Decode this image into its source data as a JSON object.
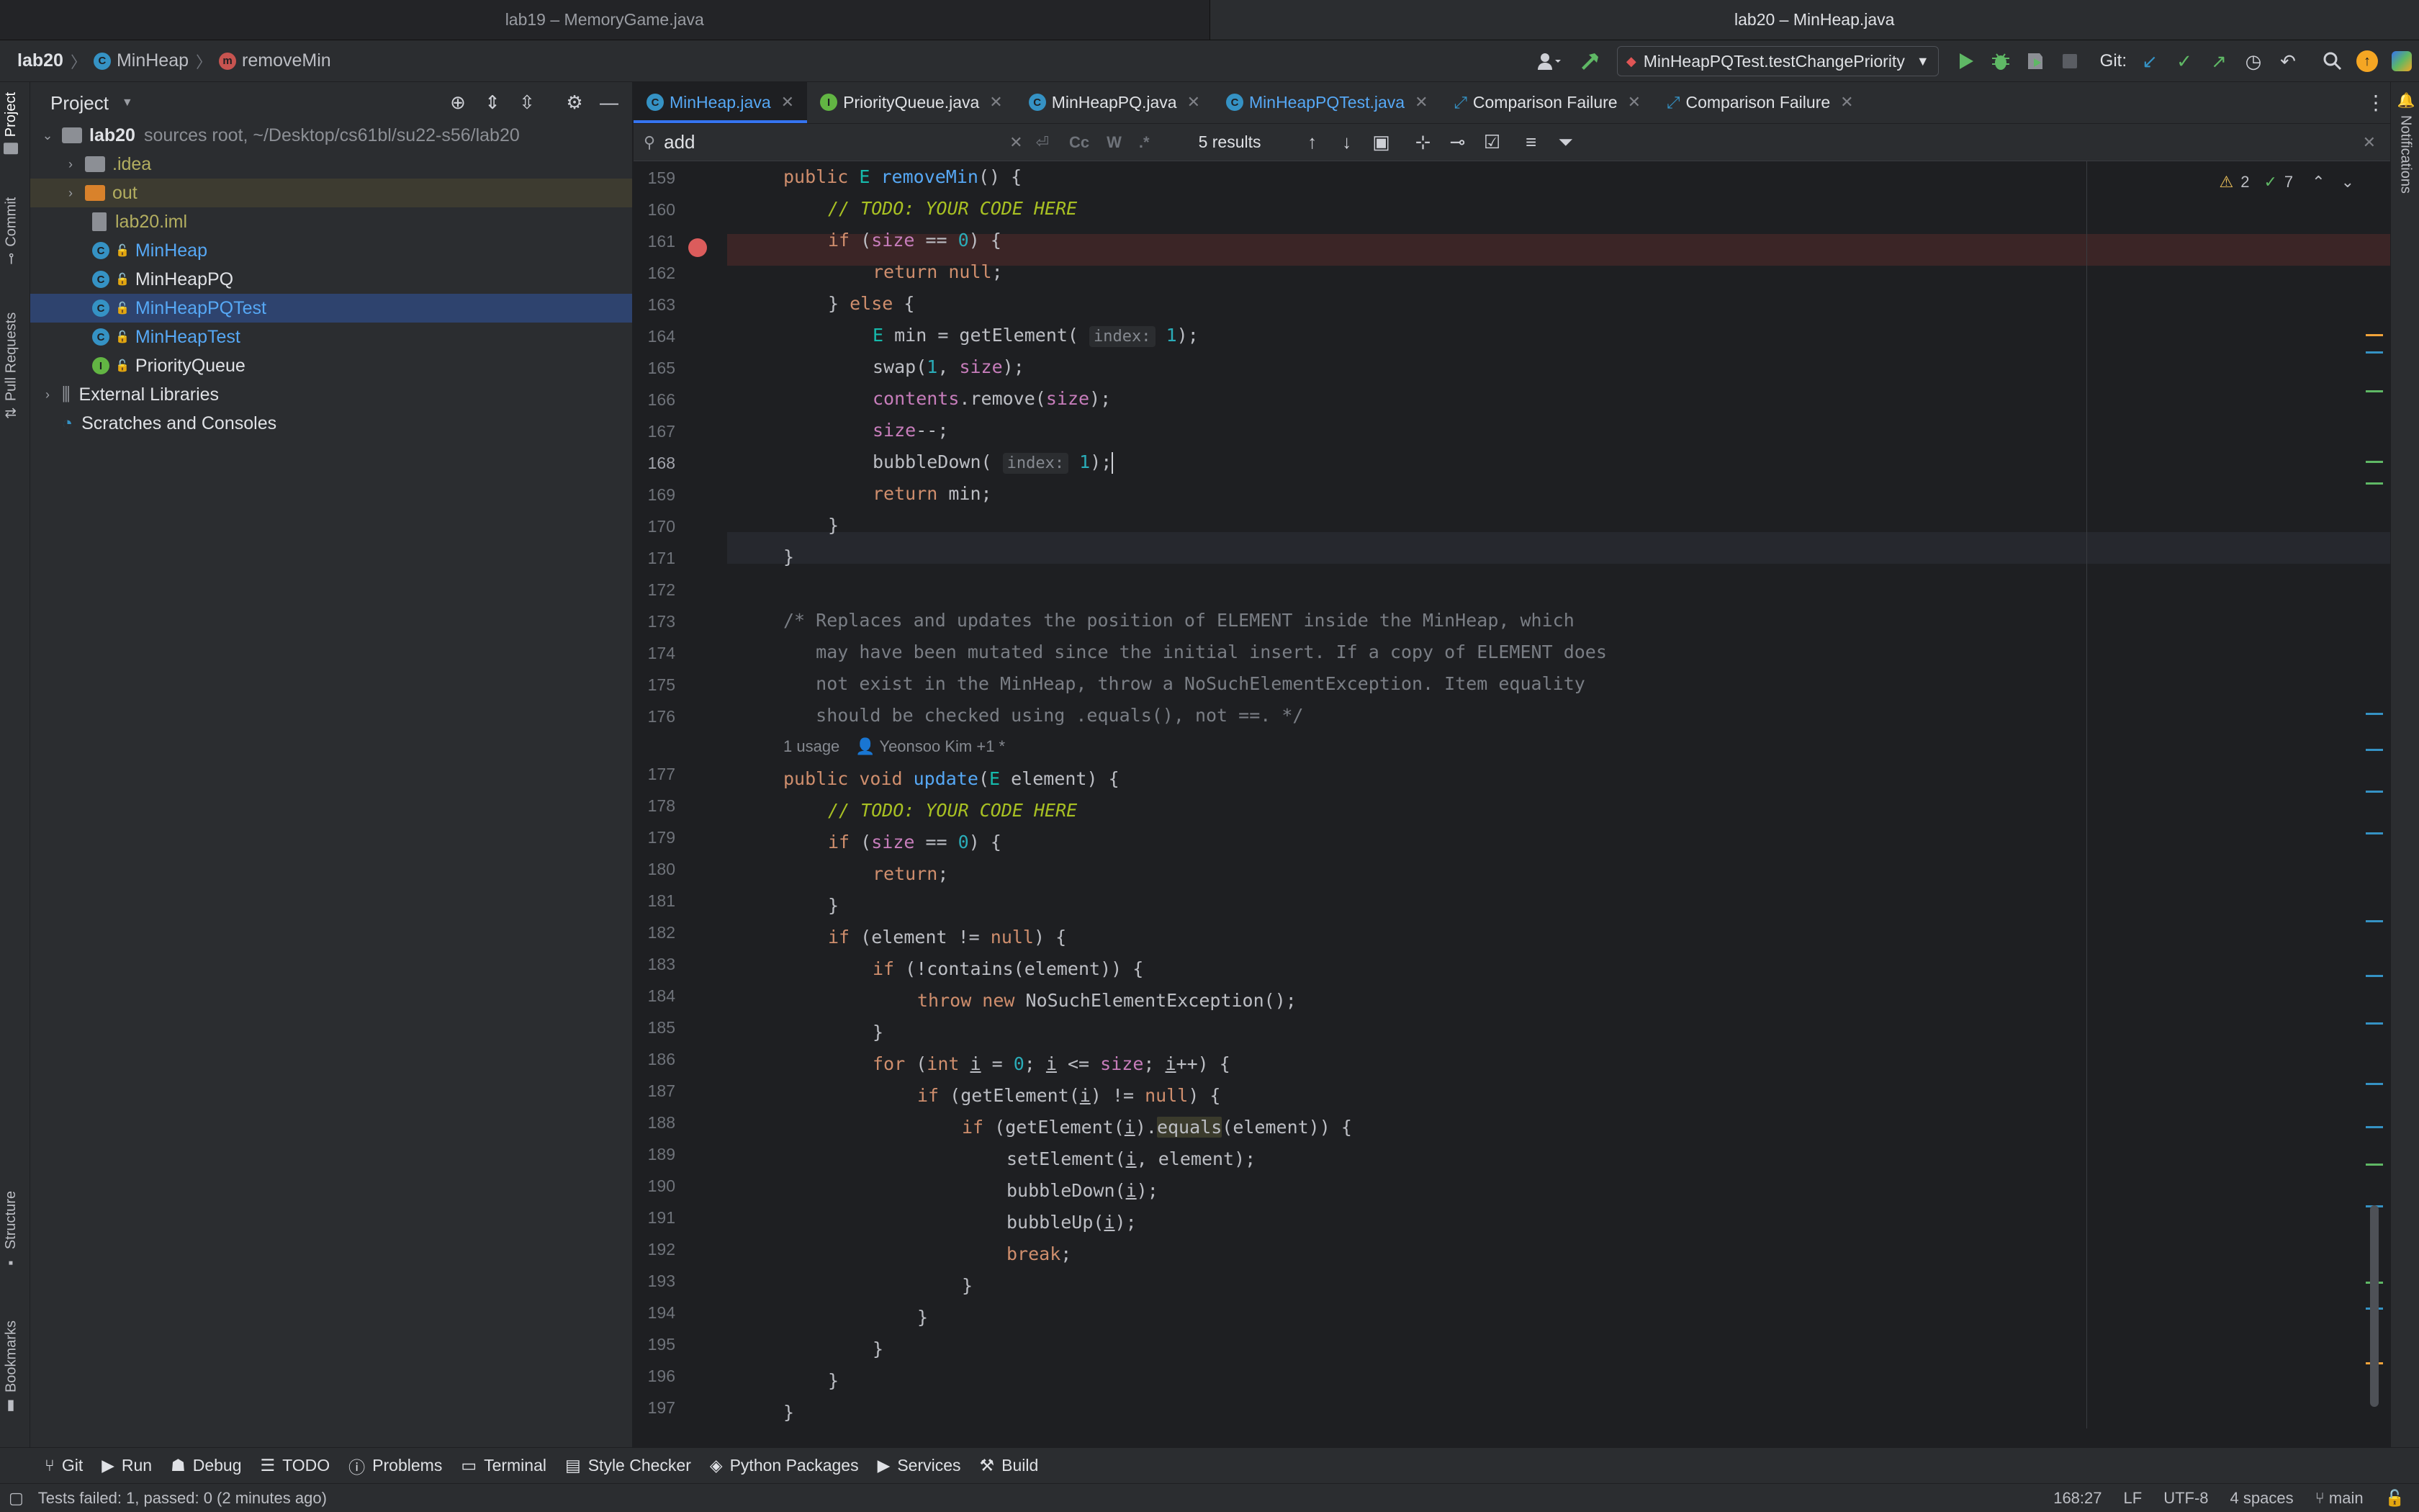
{
  "window_tabs": [
    "lab19 – MemoryGame.java",
    "lab20 – MinHeap.java"
  ],
  "breadcrumb": {
    "project": "lab20",
    "class": "MinHeap",
    "method": "removeMin"
  },
  "run_config": "MinHeapPQTest.testChangePriority",
  "git_label": "Git:",
  "project_panel": {
    "title": "Project",
    "root": {
      "name": "lab20",
      "detail": "sources root, ~/Desktop/cs61bl/su22-s56/lab20"
    },
    "items": [
      ".idea",
      "out",
      "lab20.iml",
      "MinHeap",
      "MinHeapPQ",
      "MinHeapPQTest",
      "MinHeapTest",
      "PriorityQueue"
    ],
    "external": "External Libraries",
    "scratches": "Scratches and Consoles"
  },
  "left_stripe": {
    "project": "Project",
    "commit": "Commit",
    "pull": "Pull Requests",
    "structure": "Structure",
    "bookmarks": "Bookmarks"
  },
  "right_stripe": {
    "notifications": "Notifications"
  },
  "editor_tabs": [
    "MinHeap.java",
    "PriorityQueue.java",
    "MinHeapPQ.java",
    "MinHeapPQTest.java",
    "Comparison Failure",
    "Comparison Failure"
  ],
  "find": {
    "query": "add",
    "case_label": "Cc",
    "word_label": "W",
    "regex_label": ".*",
    "results": "5 results"
  },
  "inspections": {
    "warnings": "2",
    "ok": "7"
  },
  "code": {
    "usage_info": "1 usage",
    "author": "Yeonsoo Kim +1 *",
    "line_numbers": [
      "159",
      "160",
      "161",
      "162",
      "163",
      "164",
      "165",
      "166",
      "167",
      "168",
      "169",
      "170",
      "171",
      "172",
      "173",
      "174",
      "175",
      "176",
      "",
      "177",
      "178",
      "179",
      "180",
      "181",
      "182",
      "183",
      "184",
      "185",
      "186",
      "187",
      "188",
      "189",
      "190",
      "191",
      "192",
      "193",
      "194",
      "195",
      "196",
      "197"
    ],
    "hint_index": "index:",
    "todo": "// TODO: YOUR CODE HERE",
    "comment_lines": [
      "/* Replaces and updates the position of ELEMENT inside the MinHeap, which",
      "   may have been mutated since the initial insert. If a copy of ELEMENT does",
      "   not exist in the MinHeap, throw a NoSuchElementException. Item equality",
      "   should be checked using .equals(), not ==. */"
    ]
  },
  "tool_windows": [
    "Git",
    "Run",
    "Debug",
    "TODO",
    "Problems",
    "Terminal",
    "Style Checker",
    "Python Packages",
    "Services",
    "Build"
  ],
  "status": {
    "message": "Tests failed: 1, passed: 0 (2 minutes ago)",
    "position": "168:27",
    "line_sep": "LF",
    "encoding": "UTF-8",
    "indent": "4 spaces",
    "branch": "main"
  },
  "colors": {
    "accent": "#3574f0",
    "keyword": "#cf8e6d",
    "function": "#56a8f5",
    "field": "#c77dbb",
    "number": "#2aacb8",
    "breakpoint": "#db5c5c",
    "selection": "#2e436e"
  }
}
